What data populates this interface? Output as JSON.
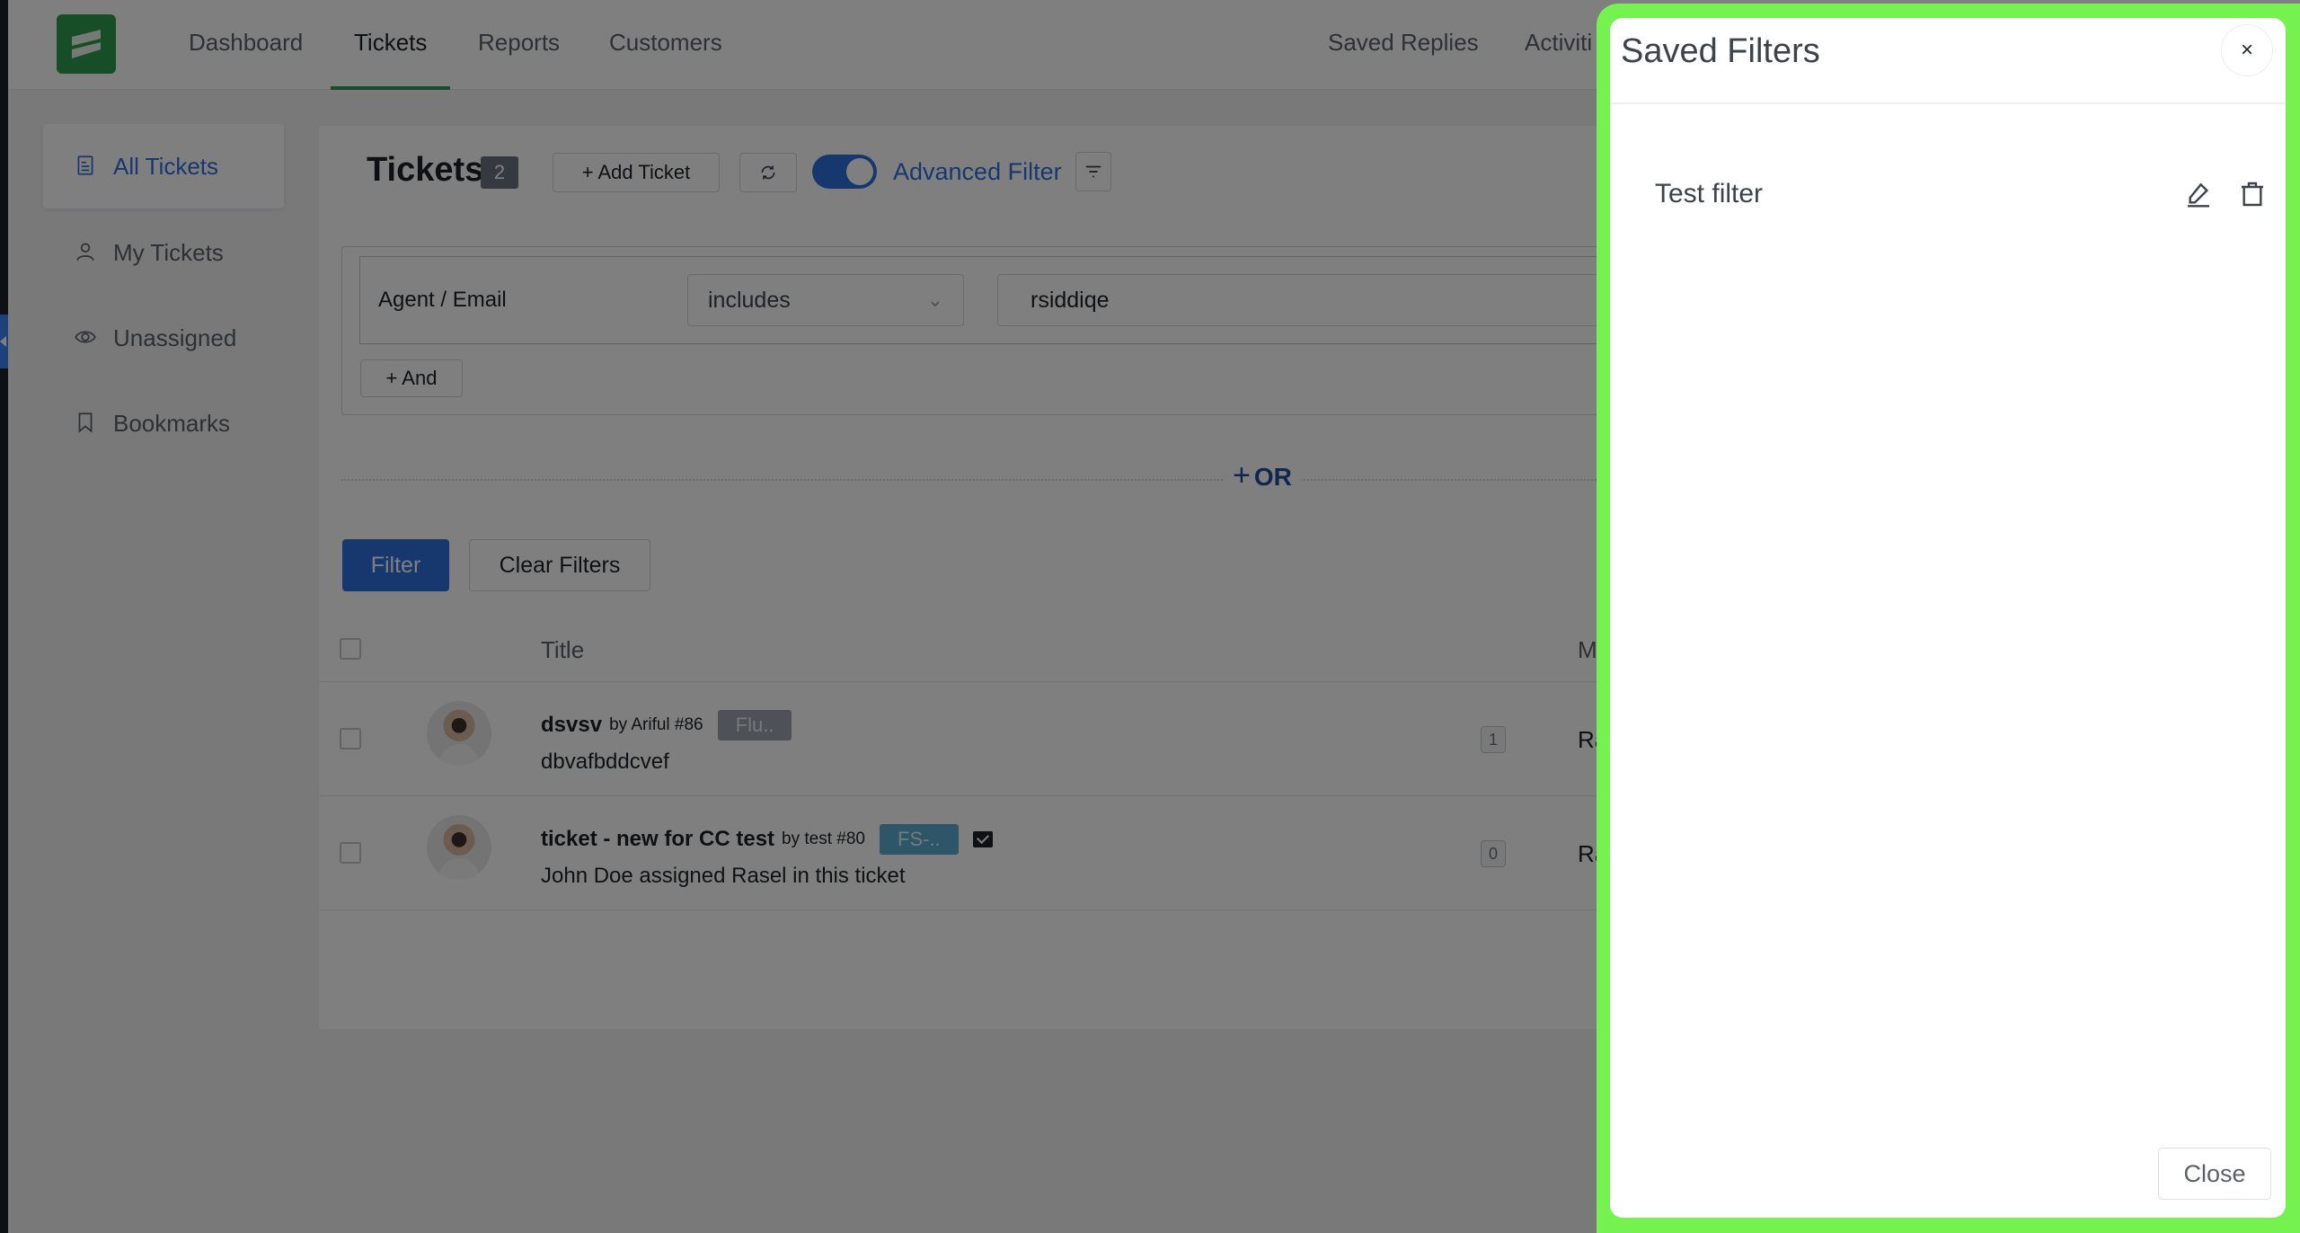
{
  "topnav": {
    "items": [
      {
        "label": "Dashboard",
        "active": false
      },
      {
        "label": "Tickets",
        "active": true
      },
      {
        "label": "Reports",
        "active": false
      },
      {
        "label": "Customers",
        "active": false
      }
    ],
    "right_items": [
      {
        "label": "Saved Replies"
      },
      {
        "label": "Activiti"
      }
    ]
  },
  "sidebar": {
    "items": [
      {
        "label": "All Tickets",
        "icon": "document-icon",
        "active": true
      },
      {
        "label": "My Tickets",
        "icon": "user-icon",
        "active": false
      },
      {
        "label": "Unassigned",
        "icon": "eye-icon",
        "active": false
      },
      {
        "label": "Bookmarks",
        "icon": "bookmark-icon",
        "active": false
      }
    ]
  },
  "tickets_header": {
    "title": "Tickets",
    "count": "2",
    "add_ticket_label": "+ Add Ticket",
    "advanced_filter_label": "Advanced Filter",
    "advanced_filter_enabled": true
  },
  "filter": {
    "field": "Agent / Email",
    "operator": "includes",
    "value": "rsiddiqe",
    "and_label": "+ And",
    "or_label": "OR",
    "filter_button": "Filter",
    "clear_button": "Clear Filters"
  },
  "table": {
    "columns": [
      "Title",
      "M"
    ],
    "rows": [
      {
        "title": "dsvsv",
        "by": "by Ariful #86",
        "tag": "Flu..",
        "tag_color": "#9ca3af",
        "has_mail_icon": false,
        "subtitle": "dbvafbddcvef",
        "replies": "1",
        "assignee": "Ra"
      },
      {
        "title": "ticket - new for CC test",
        "by": "by test #80",
        "tag": "FS-..",
        "tag_color": "#5aaed0",
        "has_mail_icon": true,
        "subtitle": "John Doe assigned Rasel in this ticket",
        "replies": "0",
        "assignee": "Ra"
      }
    ]
  },
  "drawer": {
    "title": "Saved Filters",
    "close_x": "×",
    "items": [
      {
        "name": "Test filter"
      }
    ],
    "close_button": "Close",
    "highlight_color": "#76f250"
  }
}
